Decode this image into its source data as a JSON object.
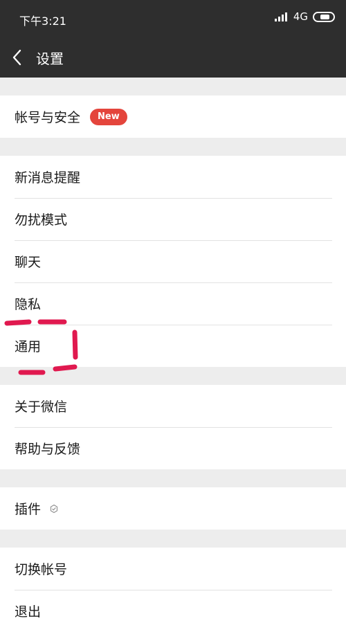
{
  "status_bar": {
    "time": "下午3:21",
    "network": "4G",
    "signal_icon": "signal-icon",
    "battery_icon": "battery-icon"
  },
  "nav": {
    "title": "设置",
    "back_icon": "chevron-left-icon"
  },
  "groups": [
    {
      "items": [
        {
          "label": "帐号与安全",
          "badge": "New"
        }
      ]
    },
    {
      "items": [
        {
          "label": "新消息提醒"
        },
        {
          "label": "勿扰模式"
        },
        {
          "label": "聊天"
        },
        {
          "label": "隐私"
        },
        {
          "label": "通用"
        }
      ]
    },
    {
      "items": [
        {
          "label": "关于微信"
        },
        {
          "label": "帮助与反馈"
        }
      ]
    },
    {
      "items": [
        {
          "label": "插件",
          "icon": "plugin-icon"
        }
      ]
    },
    {
      "items": [
        {
          "label": "切换帐号"
        },
        {
          "label": "退出"
        }
      ]
    }
  ],
  "colors": {
    "bar_background": "#2e2e2e",
    "page_background": "#ededed",
    "badge": "#e4453c",
    "annotation": "#e0194f"
  }
}
